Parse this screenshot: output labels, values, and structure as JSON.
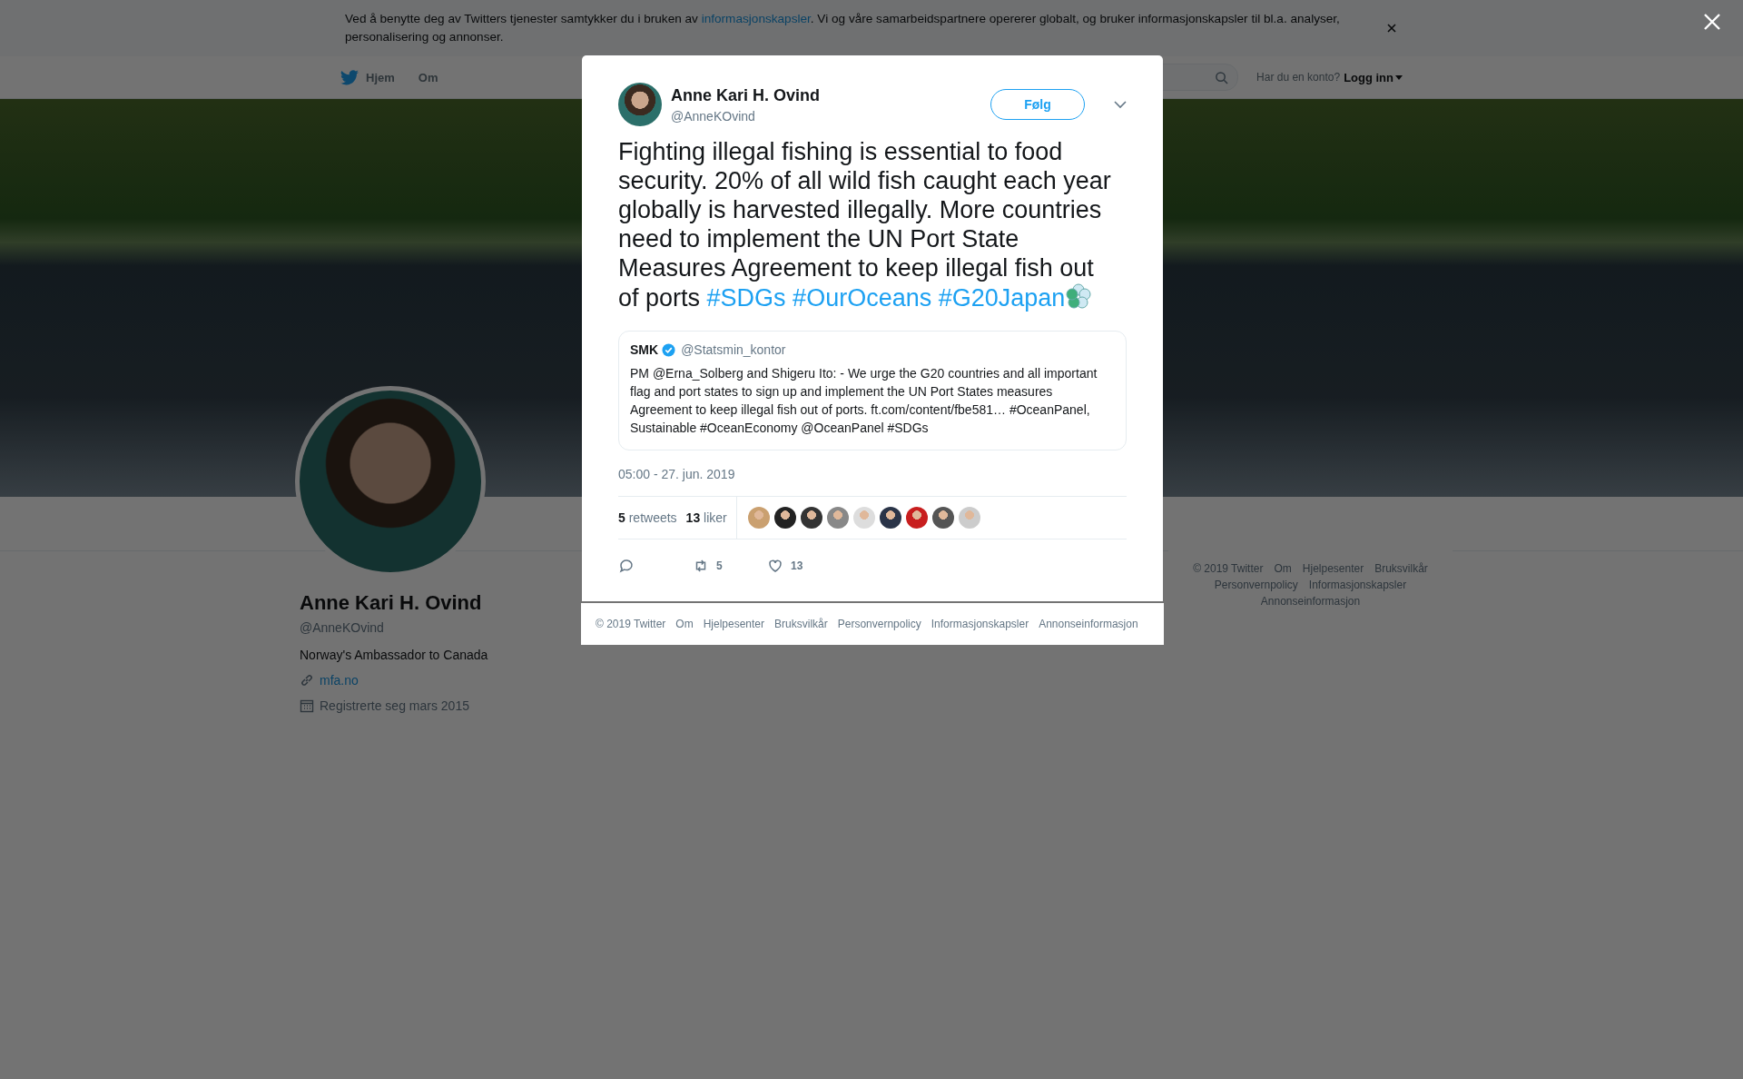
{
  "cookie_banner": {
    "text_before": "Ved å benytte deg av Twitters tjenester samtykker du i bruken av ",
    "link": "informasjonskapsler",
    "text_after": ". Vi og våre samarbeidspartnere opererer globalt, og bruker informasjonskapsler til bl.a. analyser, personalisering og annonser."
  },
  "nav": {
    "items": [
      {
        "label": "Hjem",
        "kind": "home"
      },
      {
        "label": "Om",
        "kind": "plain"
      }
    ],
    "login_prompt": "Har du en konto?",
    "login": "Logg inn"
  },
  "profile": {
    "name": "Anne Kari H. Ovind",
    "handle": "@AnneKOvind",
    "bio": "Norway's Ambassador to Canada",
    "website": "mfa.no",
    "joined": "Registrerte seg mars 2015"
  },
  "page_footer": [
    "© 2019 Twitter",
    "Om",
    "Hjelpesenter",
    "Bruksvilkår",
    "Personvernpolicy",
    "Informasjonskapsler",
    "Annonseinformasjon"
  ],
  "tweet": {
    "name": "Anne Kari H. Ovind",
    "handle": "@AnneKOvind",
    "follow": "Følg",
    "text": "Fighting illegal fishing is essential to food security. 20% of all wild fish caught each year globally is harvested illegally. More countries need to implement the UN Port State Measures Agreement to keep illegal fish out of ports",
    "hashtags": [
      "#SDGs",
      "#OurOceans",
      "#G20Japan"
    ],
    "quoted": {
      "name": "SMK",
      "verified": true,
      "handle": "@Statsmin_kontor",
      "text": "PM @Erna_Solberg and Shigeru Ito: - We urge the G20 countries and all important flag and port states to sign up and implement the UN Port States measures Agreement to keep illegal fish out of ports. ft.com/content/fbe581… #OceanPanel, Sustainable #OceanEconomy @OceanPanel #SDGs"
    },
    "time": "05:00 - 27. jun. 2019",
    "stats": [
      {
        "count": "5",
        "label": "retweets"
      },
      {
        "count": "13",
        "label": "liker"
      }
    ],
    "actions": [
      {
        "kind": "reply"
      },
      {
        "kind": "retweet",
        "count": "5"
      },
      {
        "kind": "like",
        "count": "13"
      }
    ]
  },
  "modal_footer": [
    "© 2019 Twitter",
    "Om",
    "Hjelpesenter",
    "Bruksvilkår",
    "Personvernpolicy",
    "Informasjonskapsler",
    "Annonseinformasjon"
  ]
}
